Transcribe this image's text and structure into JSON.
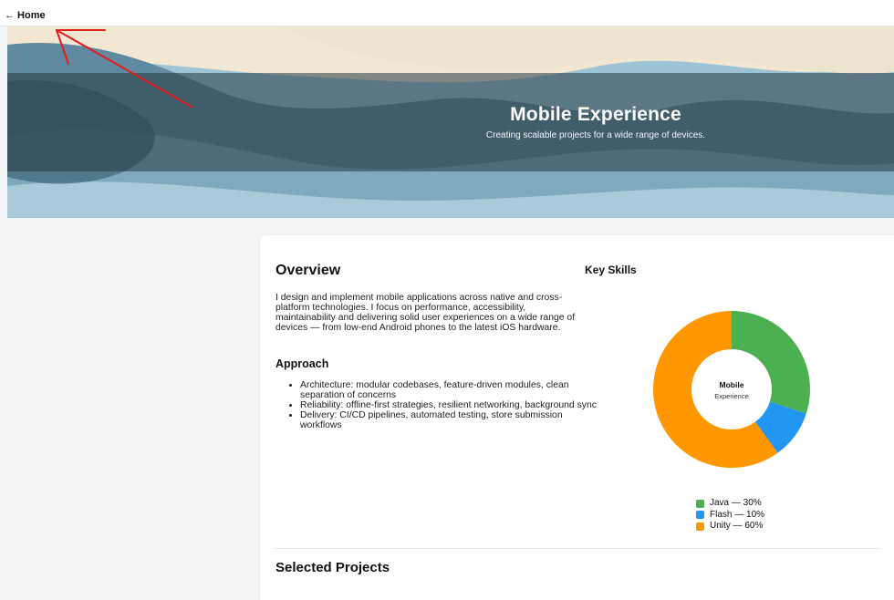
{
  "nav": {
    "home_label": "← Home"
  },
  "hero": {
    "title": "Mobile Experience",
    "subtitle": "Creating scalable projects for a wide range of devices."
  },
  "overview": {
    "title": "Overview",
    "text": "I design and implement mobile applications across native and cross-platform technologies. I focus on performance, accessibility, maintainability and delivering solid user experiences on a wide range of devices — from low-end Android phones to the latest iOS hardware."
  },
  "approach": {
    "title": "Approach",
    "items": [
      "Architecture: modular codebases, feature-driven modules, clean separation of concerns",
      "Reliability: offline-first strategies, resilient networking, background sync",
      "Delivery: CI/CD pipelines, automated testing, store submission workflows"
    ]
  },
  "skills": {
    "title": "Key Skills",
    "center_title": "Mobile",
    "center_subtitle": "Experience",
    "legend": [
      "Java — 30%",
      "Flash — 10%",
      "Unity — 60%"
    ]
  },
  "chart_data": {
    "type": "pie",
    "categories": [
      "Java",
      "Flash",
      "Unity"
    ],
    "values": [
      30,
      10,
      60
    ],
    "colors": [
      "#4caf50",
      "#2196f3",
      "#ff9800"
    ]
  },
  "projects": {
    "title": "Selected Projects"
  },
  "annotation": {
    "color": "#e11d1d"
  }
}
